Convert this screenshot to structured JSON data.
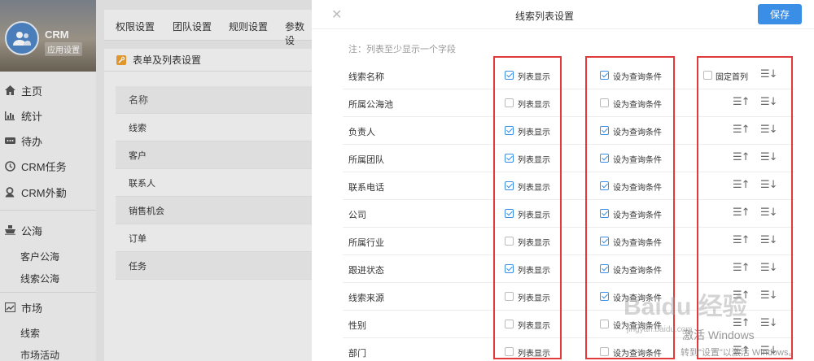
{
  "sidebar": {
    "app_name": "CRM",
    "app_sub": "应用设置",
    "nav": [
      {
        "label": "主页",
        "icon": "home-icon"
      },
      {
        "label": "统计",
        "icon": "chart-icon"
      },
      {
        "label": "待办",
        "icon": "todo-icon"
      },
      {
        "label": "CRM任务",
        "icon": "clock-icon"
      },
      {
        "label": "CRM外勤",
        "icon": "location-icon"
      }
    ],
    "section_public": {
      "label": "公海",
      "icon": "ship-icon",
      "items": [
        "客户公海",
        "线索公海"
      ]
    },
    "section_market": {
      "label": "市场",
      "icon": "trend-icon",
      "items": [
        "线索",
        "市场活动"
      ]
    }
  },
  "background": {
    "tabs": [
      "权限设置",
      "团队设置",
      "规则设置",
      "参数设"
    ],
    "panel_title": "表单及列表设置",
    "table_header": "名称",
    "table_rows": [
      "线索",
      "客户",
      "联系人",
      "销售机会",
      "订单",
      "任务"
    ]
  },
  "modal": {
    "title": "线索列表设置",
    "save_label": "保存",
    "note": "注：列表至少显示一个字段",
    "col_list_label": "列表显示",
    "col_query_label": "设为查询条件",
    "fix_first_label": "固定首列",
    "fields": [
      {
        "name": "线索名称",
        "list": true,
        "query": true
      },
      {
        "name": "所属公海池",
        "list": false,
        "query": false
      },
      {
        "name": "负责人",
        "list": true,
        "query": true
      },
      {
        "name": "所属团队",
        "list": true,
        "query": true
      },
      {
        "name": "联系电话",
        "list": true,
        "query": true
      },
      {
        "name": "公司",
        "list": true,
        "query": true
      },
      {
        "name": "所属行业",
        "list": false,
        "query": true
      },
      {
        "name": "跟进状态",
        "list": true,
        "query": true
      },
      {
        "name": "线索来源",
        "list": false,
        "query": true
      },
      {
        "name": "性别",
        "list": false,
        "query": false
      },
      {
        "name": "部门",
        "list": false,
        "query": false
      }
    ]
  },
  "watermarks": {
    "baidu": "Baidu 经验",
    "baidu_url": "jingyan.baidu.com",
    "win1": "激活 Windows",
    "win2": "转到\"设置\"以激活 Windows。"
  },
  "colors": {
    "accent": "#3a8ee6",
    "annotation": "#e03a3a"
  }
}
